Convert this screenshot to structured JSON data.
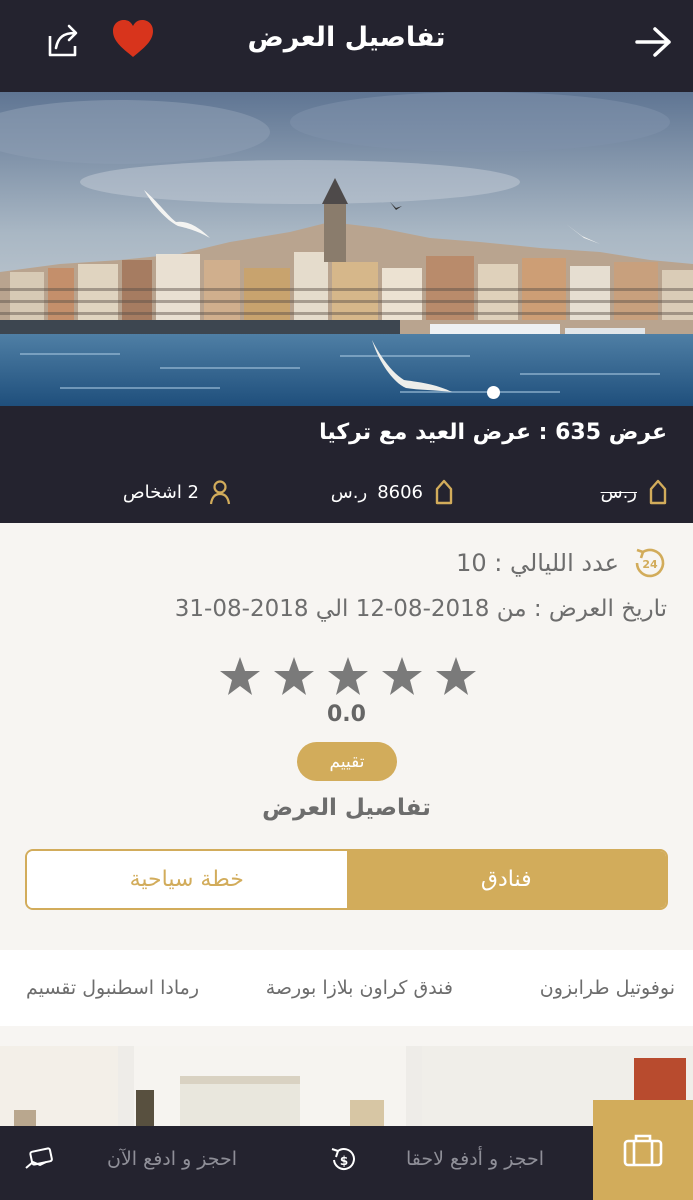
{
  "header": {
    "title": "تفاصيل العرض",
    "back_icon": "arrow-right-icon",
    "share_icon": "share-icon",
    "favorite_icon": "heart-icon"
  },
  "hero": {
    "image": "istanbul-skyline-photo",
    "slides": 2,
    "active_slide": 2
  },
  "offer": {
    "title": "عرض 635 : عرض العيد مع تركيا",
    "old_price": "ر.س",
    "price": "8606",
    "price_currency": "ر.س",
    "persons": "2 اشخاص"
  },
  "details": {
    "nights": "عدد الليالي : 10",
    "dates": "تاريخ العرض : من 2018-08-12 الي 2018-08-31",
    "rating_value": "0.0",
    "rating_stars": 0,
    "rate_button": "تقييم",
    "section_title": "تفاصيل العرض"
  },
  "tabs": {
    "hotels": "فنادق",
    "tour_plan": "خطة سياحية",
    "active": "hotels"
  },
  "hotels": [
    "نوفوتيل طرابزون",
    "فندق كراون بلازا بورصة",
    "رمادا اسطنبول تقسيم"
  ],
  "bottom_bar": {
    "pay_later": "احجز و أدفع لاحقا",
    "pay_now": "احجز و ادفع الآن"
  },
  "colors": {
    "dark": "#24232f",
    "gold": "#d2ac5b",
    "heart": "#d8341c"
  }
}
